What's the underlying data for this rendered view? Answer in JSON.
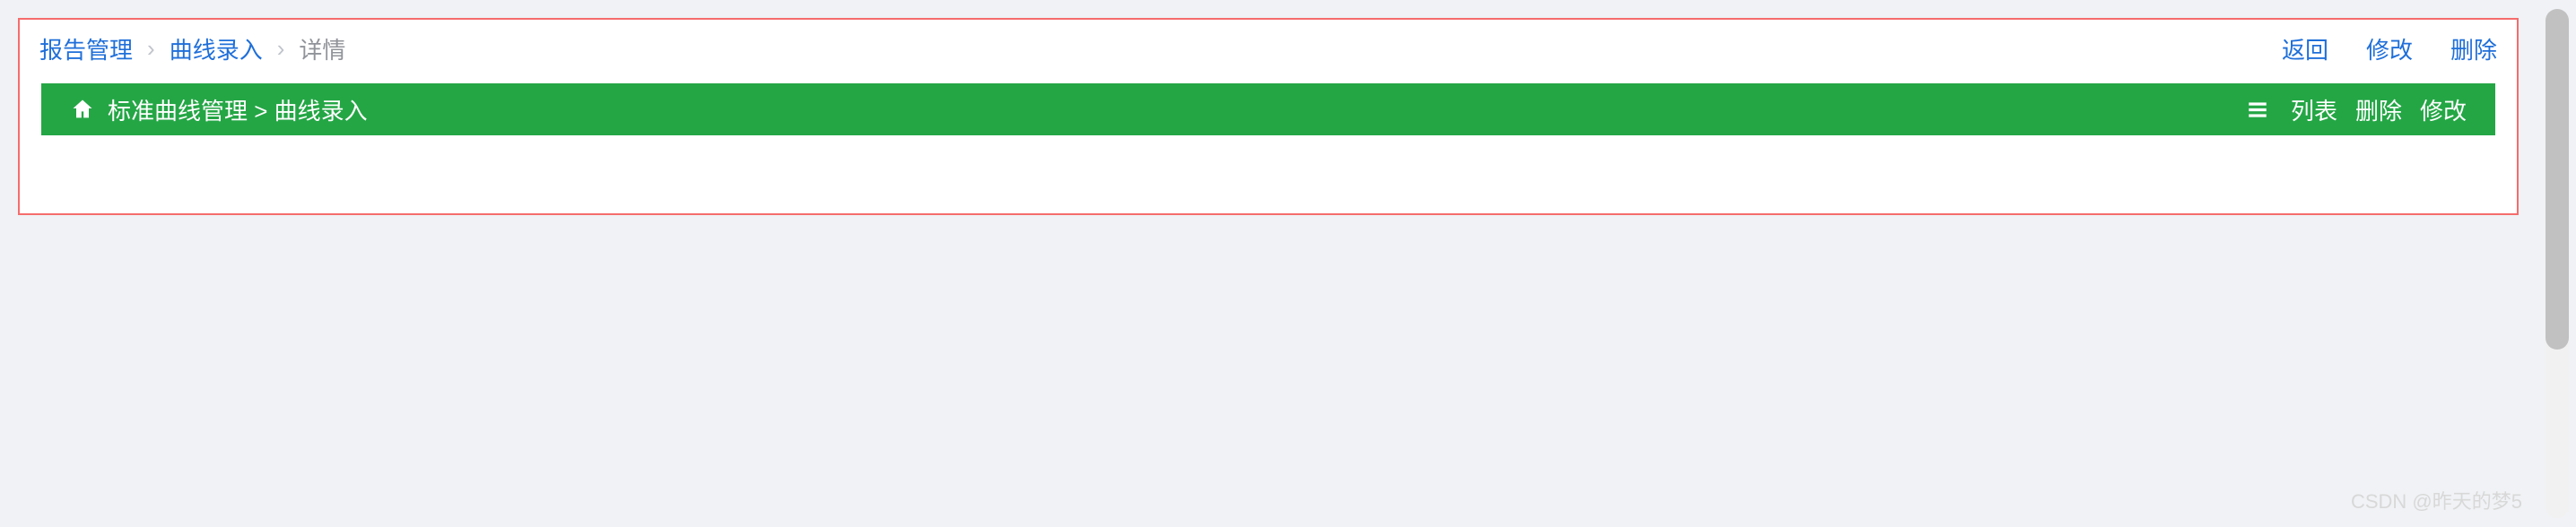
{
  "breadcrumb": {
    "items": [
      "报告管理",
      "曲线录入",
      "详情"
    ],
    "actions": {
      "back": "返回",
      "edit": "修改",
      "delete": "删除"
    }
  },
  "greenbar": {
    "path": "标准曲线管理 > 曲线录入",
    "actions": {
      "list": "列表",
      "delete": "删除",
      "edit": "修改"
    }
  },
  "watermark": "CSDN @昨天的梦5"
}
